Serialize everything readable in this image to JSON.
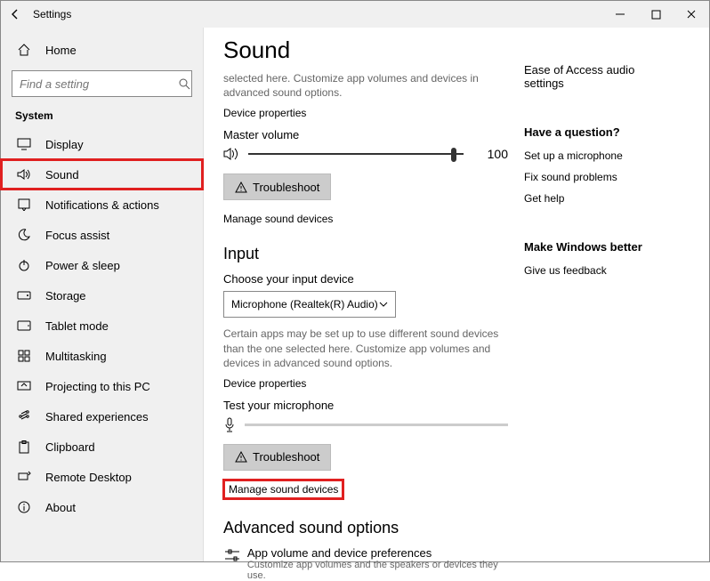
{
  "window": {
    "title": "Settings"
  },
  "sidebar": {
    "home_label": "Home",
    "search_placeholder": "Find a setting",
    "section_label": "System",
    "items": [
      {
        "label": "Display",
        "icon": "display"
      },
      {
        "label": "Sound",
        "icon": "sound"
      },
      {
        "label": "Notifications & actions",
        "icon": "notifications"
      },
      {
        "label": "Focus assist",
        "icon": "moon"
      },
      {
        "label": "Power & sleep",
        "icon": "power"
      },
      {
        "label": "Storage",
        "icon": "storage"
      },
      {
        "label": "Tablet mode",
        "icon": "tablet"
      },
      {
        "label": "Multitasking",
        "icon": "multitask"
      },
      {
        "label": "Projecting to this PC",
        "icon": "project"
      },
      {
        "label": "Shared experiences",
        "icon": "shared"
      },
      {
        "label": "Clipboard",
        "icon": "clipboard"
      },
      {
        "label": "Remote Desktop",
        "icon": "remote"
      },
      {
        "label": "About",
        "icon": "about"
      }
    ]
  },
  "main": {
    "heading": "Sound",
    "output_desc": "selected here. Customize app volumes and devices in advanced sound options.",
    "device_properties": "Device properties",
    "master_volume_label": "Master volume",
    "master_volume_value": "100",
    "troubleshoot_label": "Troubleshoot",
    "manage_sound_devices": "Manage sound devices",
    "input_heading": "Input",
    "choose_input_label": "Choose your input device",
    "input_selected": "Microphone (Realtek(R) Audio)",
    "input_desc": "Certain apps may be set up to use different sound devices than the one selected here. Customize app volumes and devices in advanced sound options.",
    "test_mic_label": "Test your microphone",
    "advanced_heading": "Advanced sound options",
    "adv_item_title": "App volume and device preferences",
    "adv_item_desc": "Customize app volumes and the speakers or devices they use."
  },
  "aside": {
    "top_link": "Ease of Access audio settings",
    "q_heading": "Have a question?",
    "q_links": {
      "a": "Set up a microphone",
      "b": "Fix sound problems",
      "c": "Get help"
    },
    "better_heading": "Make Windows better",
    "feedback": "Give us feedback"
  }
}
